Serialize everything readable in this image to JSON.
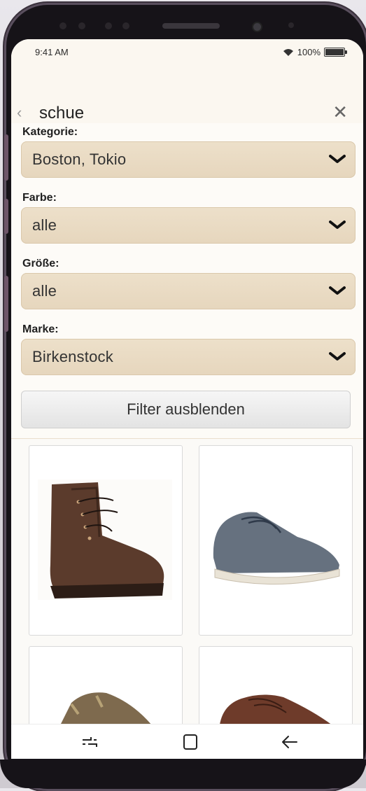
{
  "status_bar": {
    "time": "9:41 AM",
    "battery": "100%"
  },
  "search": {
    "query": "schue"
  },
  "filters": [
    {
      "label": "Kategorie:",
      "value": "Boston, Tokio"
    },
    {
      "label": "Farbe:",
      "value": "alle"
    },
    {
      "label": "Größe:",
      "value": "alle"
    },
    {
      "label": "Marke:",
      "value": "Birkenstock"
    }
  ],
  "toggle_button": "Filter ausblenden",
  "products": [
    {
      "image": "brown-leather-lace-up-boot"
    },
    {
      "image": "grey-suede-chukka-sneaker"
    },
    {
      "image": "brown-toe-post-sandal"
    },
    {
      "image": "brown-leather-low-sneaker"
    }
  ],
  "colors": {
    "accent_beige": "#e8d9c0",
    "bezel": "#161318"
  }
}
